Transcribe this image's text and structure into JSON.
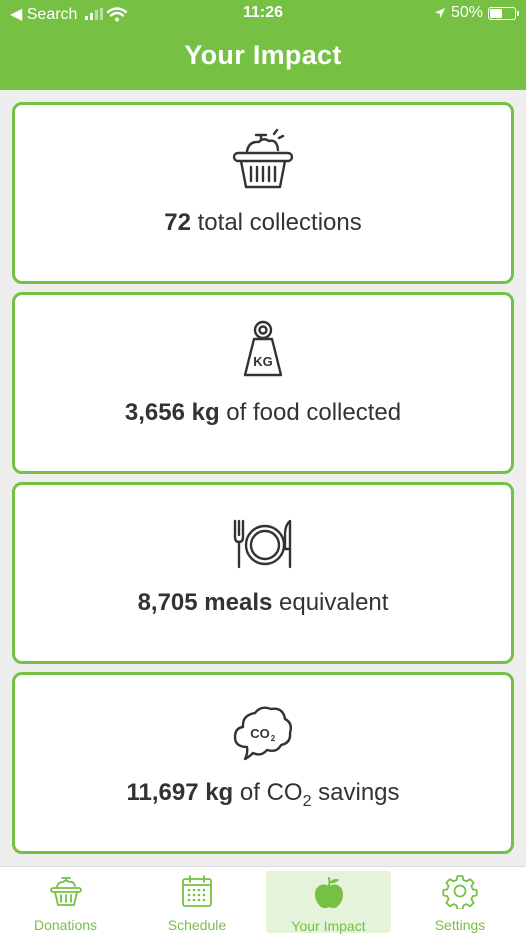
{
  "status_bar": {
    "back_label": "◀ Search",
    "time": "11:26",
    "battery": "50%"
  },
  "header": {
    "title": "Your Impact"
  },
  "stats": [
    {
      "value": "72",
      "label": " total collections",
      "icon": "basket-icon"
    },
    {
      "value": "3,656 kg",
      "label": " of food collected",
      "icon": "weight-icon",
      "icon_text": "KG"
    },
    {
      "value": "8,705 meals",
      "label": " equivalent",
      "icon": "plate-cutlery-icon"
    },
    {
      "value": "11,697 kg",
      "label_pre": " of CO",
      "label_sub": "2",
      "label_post": " savings",
      "icon": "co2-cloud-icon",
      "icon_text": "CO"
    }
  ],
  "tabs": [
    {
      "label": "Donations",
      "icon": "basket-icon"
    },
    {
      "label": "Schedule",
      "icon": "calendar-icon"
    },
    {
      "label": "Your Impact",
      "icon": "apple-icon",
      "active": true
    },
    {
      "label": "Settings",
      "icon": "gear-icon"
    }
  ],
  "colors": {
    "accent": "#76c043",
    "active_tab_bg": "#e4f3d9",
    "text": "#333333"
  }
}
